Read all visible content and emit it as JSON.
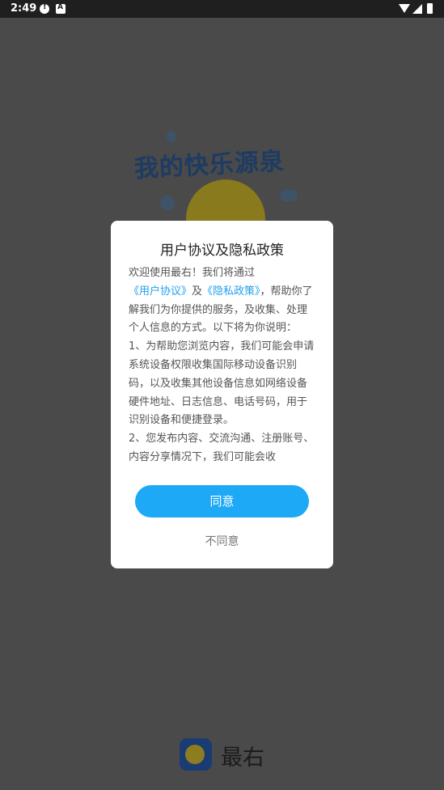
{
  "status_bar": {
    "time": "2:49",
    "icons": [
      "alert-icon",
      "a-icon",
      "wifi-icon",
      "signal-icon",
      "battery-icon"
    ]
  },
  "splash": {
    "title": "我的快乐源泉"
  },
  "dialog": {
    "title": "用户协议及隐私政策",
    "intro_before": "欢迎使用最右！我们将通过",
    "link_user_agreement": "《用户协议》",
    "and": "及",
    "link_privacy_policy": "《隐私政策》",
    "intro_after": "，帮助你了解我们为你提供的服务，及收集、处理个人信息的方式。以下将为你说明：",
    "point1": "1、为帮助您浏览内容，我们可能会申请系统设备权限收集国际移动设备识别码，以及收集其他设备信息如网络设备硬件地址、日志信息、电话号码，用于识别设备和便捷登录。",
    "point2": "2、您发布内容、交流沟通、注册账号、内容分享情况下，我们可能会收",
    "agree_label": "同意",
    "disagree_label": "不同意"
  },
  "brand": {
    "name": "最右"
  },
  "colors": {
    "accent": "#1ea9f7",
    "link": "#1ea0ee",
    "overlay": "#4a4a4a"
  }
}
